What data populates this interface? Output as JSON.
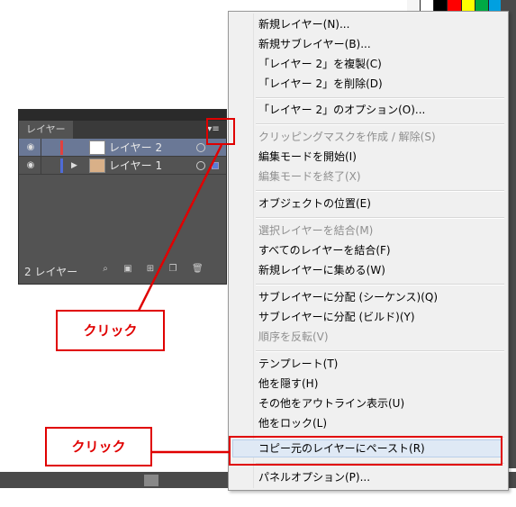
{
  "swatch_colors": [
    "#f5f5f5",
    "#ffffff",
    "#000000",
    "#ff0000",
    "#ffff00",
    "#00aa44",
    "#00a0e0",
    "#2030a0"
  ],
  "layers_panel": {
    "tab_label": "レイヤー",
    "menu_button_icon": "panel-menu-icon",
    "layers": [
      {
        "name": "レイヤー 2",
        "color": "#e0413f",
        "selected": true,
        "thumbnail": "blank"
      },
      {
        "name": "レイヤー 1",
        "color": "#4f6bd6",
        "selected": false,
        "thumbnail": "illustration"
      }
    ],
    "footer_count": "2 レイヤー"
  },
  "context_menu": {
    "groups": [
      [
        {
          "label": "新規レイヤー(N)...",
          "enabled": true
        },
        {
          "label": "新規サブレイヤー(B)...",
          "enabled": true
        },
        {
          "label": "「レイヤー 2」を複製(C)",
          "enabled": true
        },
        {
          "label": "「レイヤー 2」を削除(D)",
          "enabled": true
        }
      ],
      [
        {
          "label": "「レイヤー 2」のオプション(O)...",
          "enabled": true
        }
      ],
      [
        {
          "label": "クリッピングマスクを作成 / 解除(S)",
          "enabled": false
        },
        {
          "label": "編集モードを開始(I)",
          "enabled": true
        },
        {
          "label": "編集モードを終了(X)",
          "enabled": false
        }
      ],
      [
        {
          "label": "オブジェクトの位置(E)",
          "enabled": true
        }
      ],
      [
        {
          "label": "選択レイヤーを結合(M)",
          "enabled": false
        },
        {
          "label": "すべてのレイヤーを結合(F)",
          "enabled": true
        },
        {
          "label": "新規レイヤーに集める(W)",
          "enabled": true
        }
      ],
      [
        {
          "label": "サブレイヤーに分配 (シーケンス)(Q)",
          "enabled": true
        },
        {
          "label": "サブレイヤーに分配 (ビルド)(Y)",
          "enabled": true
        },
        {
          "label": "順序を反転(V)",
          "enabled": false
        }
      ],
      [
        {
          "label": "テンプレート(T)",
          "enabled": true
        },
        {
          "label": "他を隠す(H)",
          "enabled": true
        },
        {
          "label": "その他をアウトライン表示(U)",
          "enabled": true
        },
        {
          "label": "他をロック(L)",
          "enabled": true
        }
      ],
      [
        {
          "label": "コピー元のレイヤーにペースト(R)",
          "enabled": true,
          "highlighted": true
        }
      ],
      [
        {
          "label": "パネルオプション(P)...",
          "enabled": true
        }
      ]
    ]
  },
  "annotations": {
    "callout_1": "クリック",
    "callout_2": "クリック",
    "color": "#e00000"
  }
}
